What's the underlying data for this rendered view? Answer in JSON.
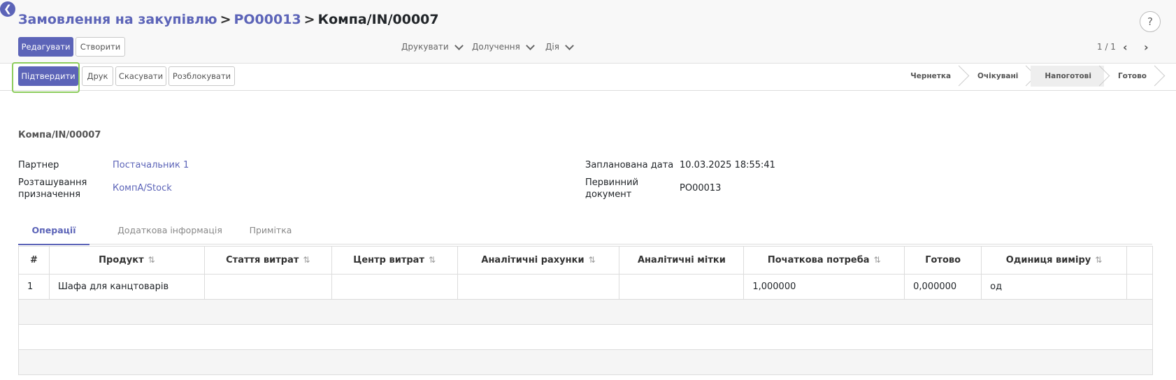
{
  "breadcrumb": {
    "root": "Замовлення на закупівлю",
    "po": "PO00013",
    "current": "Компа/IN/00007"
  },
  "help": {
    "label": "?"
  },
  "toolbar": {
    "edit": "Редагувати",
    "create": "Створити",
    "print_menu": "Друкувати",
    "attach_menu": "Долучення",
    "action_menu": "Дія",
    "pager": "1 / 1"
  },
  "statusbar": {
    "confirm": "Підтвердити",
    "print": "Друк",
    "cancel": "Скасувати",
    "unlock": "Розблокувати",
    "stages": [
      "Чернетка",
      "Очікувані",
      "Напоготові",
      "Готово"
    ]
  },
  "form": {
    "name": "Компа/IN/00007",
    "partner_label": "Партнер",
    "partner_value": "Постачальник 1",
    "dest_label_1": "Розташування",
    "dest_label_2": "призначення",
    "dest_value": "КомпА/Stock",
    "date_label": "Запланована дата",
    "date_value": "10.03.2025 18:55:41",
    "origin_label_1": "Первинний",
    "origin_label_2": "документ",
    "origin_value": "PO00013"
  },
  "tabs": [
    "Операції",
    "Додаткова інформація",
    "Примітка"
  ],
  "table": {
    "headers": [
      "#",
      "Продукт",
      "Стаття витрат",
      "Центр витрат",
      "Аналітичні рахунки",
      "Аналітичні мітки",
      "Початкова потреба",
      "Готово",
      "Одиниця виміру"
    ],
    "rows": [
      [
        "1",
        "Шафа для канцтоварів",
        "",
        "",
        "",
        "",
        "1,000000",
        "0,000000",
        "од"
      ]
    ]
  }
}
